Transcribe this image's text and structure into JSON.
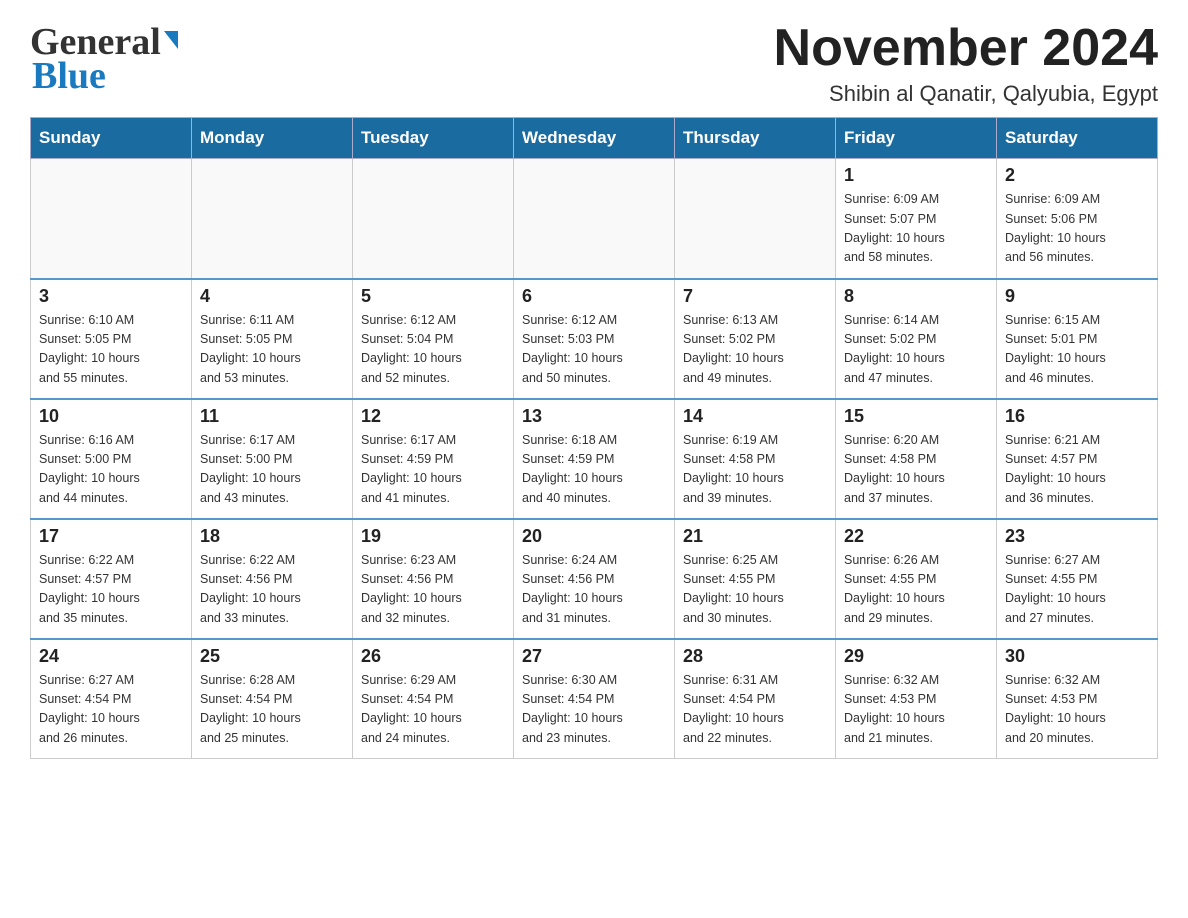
{
  "header": {
    "logo_general": "General",
    "logo_blue": "Blue",
    "title": "November 2024",
    "location": "Shibin al Qanatir, Qalyubia, Egypt"
  },
  "calendar": {
    "days_of_week": [
      "Sunday",
      "Monday",
      "Tuesday",
      "Wednesday",
      "Thursday",
      "Friday",
      "Saturday"
    ],
    "weeks": [
      [
        {
          "day": "",
          "info": ""
        },
        {
          "day": "",
          "info": ""
        },
        {
          "day": "",
          "info": ""
        },
        {
          "day": "",
          "info": ""
        },
        {
          "day": "",
          "info": ""
        },
        {
          "day": "1",
          "info": "Sunrise: 6:09 AM\nSunset: 5:07 PM\nDaylight: 10 hours\nand 58 minutes."
        },
        {
          "day": "2",
          "info": "Sunrise: 6:09 AM\nSunset: 5:06 PM\nDaylight: 10 hours\nand 56 minutes."
        }
      ],
      [
        {
          "day": "3",
          "info": "Sunrise: 6:10 AM\nSunset: 5:05 PM\nDaylight: 10 hours\nand 55 minutes."
        },
        {
          "day": "4",
          "info": "Sunrise: 6:11 AM\nSunset: 5:05 PM\nDaylight: 10 hours\nand 53 minutes."
        },
        {
          "day": "5",
          "info": "Sunrise: 6:12 AM\nSunset: 5:04 PM\nDaylight: 10 hours\nand 52 minutes."
        },
        {
          "day": "6",
          "info": "Sunrise: 6:12 AM\nSunset: 5:03 PM\nDaylight: 10 hours\nand 50 minutes."
        },
        {
          "day": "7",
          "info": "Sunrise: 6:13 AM\nSunset: 5:02 PM\nDaylight: 10 hours\nand 49 minutes."
        },
        {
          "day": "8",
          "info": "Sunrise: 6:14 AM\nSunset: 5:02 PM\nDaylight: 10 hours\nand 47 minutes."
        },
        {
          "day": "9",
          "info": "Sunrise: 6:15 AM\nSunset: 5:01 PM\nDaylight: 10 hours\nand 46 minutes."
        }
      ],
      [
        {
          "day": "10",
          "info": "Sunrise: 6:16 AM\nSunset: 5:00 PM\nDaylight: 10 hours\nand 44 minutes."
        },
        {
          "day": "11",
          "info": "Sunrise: 6:17 AM\nSunset: 5:00 PM\nDaylight: 10 hours\nand 43 minutes."
        },
        {
          "day": "12",
          "info": "Sunrise: 6:17 AM\nSunset: 4:59 PM\nDaylight: 10 hours\nand 41 minutes."
        },
        {
          "day": "13",
          "info": "Sunrise: 6:18 AM\nSunset: 4:59 PM\nDaylight: 10 hours\nand 40 minutes."
        },
        {
          "day": "14",
          "info": "Sunrise: 6:19 AM\nSunset: 4:58 PM\nDaylight: 10 hours\nand 39 minutes."
        },
        {
          "day": "15",
          "info": "Sunrise: 6:20 AM\nSunset: 4:58 PM\nDaylight: 10 hours\nand 37 minutes."
        },
        {
          "day": "16",
          "info": "Sunrise: 6:21 AM\nSunset: 4:57 PM\nDaylight: 10 hours\nand 36 minutes."
        }
      ],
      [
        {
          "day": "17",
          "info": "Sunrise: 6:22 AM\nSunset: 4:57 PM\nDaylight: 10 hours\nand 35 minutes."
        },
        {
          "day": "18",
          "info": "Sunrise: 6:22 AM\nSunset: 4:56 PM\nDaylight: 10 hours\nand 33 minutes."
        },
        {
          "day": "19",
          "info": "Sunrise: 6:23 AM\nSunset: 4:56 PM\nDaylight: 10 hours\nand 32 minutes."
        },
        {
          "day": "20",
          "info": "Sunrise: 6:24 AM\nSunset: 4:56 PM\nDaylight: 10 hours\nand 31 minutes."
        },
        {
          "day": "21",
          "info": "Sunrise: 6:25 AM\nSunset: 4:55 PM\nDaylight: 10 hours\nand 30 minutes."
        },
        {
          "day": "22",
          "info": "Sunrise: 6:26 AM\nSunset: 4:55 PM\nDaylight: 10 hours\nand 29 minutes."
        },
        {
          "day": "23",
          "info": "Sunrise: 6:27 AM\nSunset: 4:55 PM\nDaylight: 10 hours\nand 27 minutes."
        }
      ],
      [
        {
          "day": "24",
          "info": "Sunrise: 6:27 AM\nSunset: 4:54 PM\nDaylight: 10 hours\nand 26 minutes."
        },
        {
          "day": "25",
          "info": "Sunrise: 6:28 AM\nSunset: 4:54 PM\nDaylight: 10 hours\nand 25 minutes."
        },
        {
          "day": "26",
          "info": "Sunrise: 6:29 AM\nSunset: 4:54 PM\nDaylight: 10 hours\nand 24 minutes."
        },
        {
          "day": "27",
          "info": "Sunrise: 6:30 AM\nSunset: 4:54 PM\nDaylight: 10 hours\nand 23 minutes."
        },
        {
          "day": "28",
          "info": "Sunrise: 6:31 AM\nSunset: 4:54 PM\nDaylight: 10 hours\nand 22 minutes."
        },
        {
          "day": "29",
          "info": "Sunrise: 6:32 AM\nSunset: 4:53 PM\nDaylight: 10 hours\nand 21 minutes."
        },
        {
          "day": "30",
          "info": "Sunrise: 6:32 AM\nSunset: 4:53 PM\nDaylight: 10 hours\nand 20 minutes."
        }
      ]
    ]
  }
}
